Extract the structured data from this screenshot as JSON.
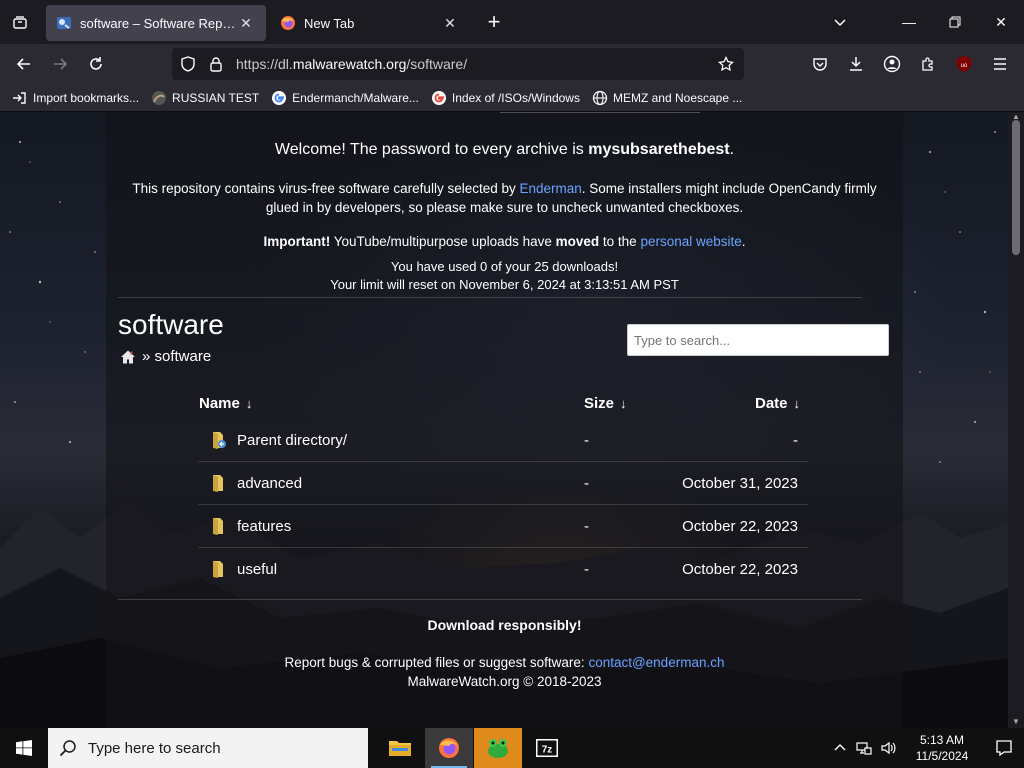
{
  "browser": {
    "tabs": [
      {
        "title": "software – Software Repository",
        "active": true
      },
      {
        "title": "New Tab",
        "active": false
      }
    ],
    "url": {
      "prefix": "https://dl.",
      "host": "malwarewatch.org",
      "path": "/software/"
    },
    "bookmarks": [
      {
        "label": "Import bookmarks...",
        "icon": "import-icon"
      },
      {
        "label": "RUSSIAN TEST",
        "icon": "bookmark-favicon"
      },
      {
        "label": "Endermanch/Malware...",
        "icon": "google-icon"
      },
      {
        "label": "Index of /ISOs/Windows",
        "icon": "google-icon"
      },
      {
        "label": "MEMZ and Noescape ...",
        "icon": "globe-icon"
      }
    ]
  },
  "page": {
    "welcome_prefix": "Welcome! The password to every archive is ",
    "password": "mysubsarethebest",
    "welcome_suffix": ".",
    "desc_before": "This repository contains virus-free software carefully selected by ",
    "desc_link": "Enderman",
    "desc_after": ". Some installers might include OpenCandy firmly glued in by developers, so please make sure to uncheck unwanted checkboxes.",
    "important_label": "Important!",
    "important_mid": " YouTube/multipurpose uploads have ",
    "important_moved": "moved",
    "important_to": " to the ",
    "important_link": "personal website",
    "important_end": ".",
    "used_line": "You have used 0 of your 25 downloads!",
    "reset_line": "Your limit will reset on November 6, 2024 at 3:13:51 AM PST",
    "heading": "software",
    "breadcrumb": "» software",
    "search_placeholder": "Type to search...",
    "columns": {
      "name": "Name",
      "size": "Size",
      "date": "Date",
      "sort_arrow": "↓"
    },
    "rows": [
      {
        "name": "Parent directory/",
        "size": "-",
        "date": "-"
      },
      {
        "name": "advanced",
        "size": "-",
        "date": "October 31, 2023"
      },
      {
        "name": "features",
        "size": "-",
        "date": "October 22, 2023"
      },
      {
        "name": "useful",
        "size": "-",
        "date": "October 22, 2023"
      }
    ],
    "download_responsibly": "Download responsibly!",
    "report_text": "Report bugs & corrupted files or suggest software: ",
    "contact_email": "contact@enderman.ch",
    "copyright": "MalwareWatch.org © 2018-2023"
  },
  "taskbar": {
    "search_placeholder": "Type here to search",
    "apps": [
      "file-explorer",
      "firefox",
      "green-frog-app",
      "7zip"
    ],
    "time": "5:13 AM",
    "date": "11/5/2024"
  },
  "colors": {
    "link": "#6aa3ff",
    "tab_active": "#42414d",
    "toolbar": "#2b2a33"
  }
}
